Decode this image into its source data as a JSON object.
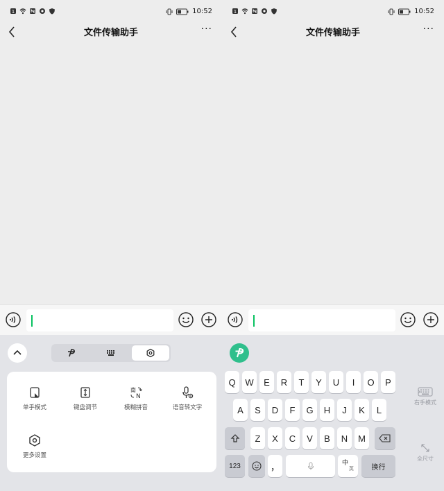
{
  "screens": [
    {
      "status": {
        "time": "10:52"
      },
      "nav": {
        "title": "文件传输助手"
      },
      "input": {
        "value": ""
      },
      "keyboard_menu": {
        "items": [
          {
            "label": "单手模式",
            "icon": "one-hand-mode-icon"
          },
          {
            "label": "键盘调节",
            "icon": "keyboard-adjust-icon"
          },
          {
            "label": "模糊拼音",
            "icon": "fuzzy-pinyin-icon"
          },
          {
            "label": "语音转文字",
            "icon": "voice-to-text-icon"
          },
          {
            "label": "更多设置",
            "icon": "more-settings-icon"
          }
        ]
      }
    },
    {
      "status": {
        "time": "10:52"
      },
      "nav": {
        "title": "文件传输助手"
      },
      "input": {
        "value": ""
      },
      "keyboard": {
        "row1": [
          "Q",
          "W",
          "E",
          "R",
          "T",
          "Y",
          "U",
          "I",
          "O",
          "P"
        ],
        "row2": [
          "A",
          "S",
          "D",
          "F",
          "G",
          "H",
          "J",
          "K",
          "L"
        ],
        "row3": [
          "Z",
          "X",
          "C",
          "V",
          "B",
          "N",
          "M"
        ],
        "num_label": "123",
        "punct_label": "，",
        "lang_top": "中",
        "lang_bottom": "英",
        "enter_label": "换行",
        "side_right_hand": "右手模式",
        "side_full_size": "全尺寸"
      }
    }
  ],
  "colors": {
    "accent": "#07c160",
    "brand_logo": "#2fbf8c"
  }
}
